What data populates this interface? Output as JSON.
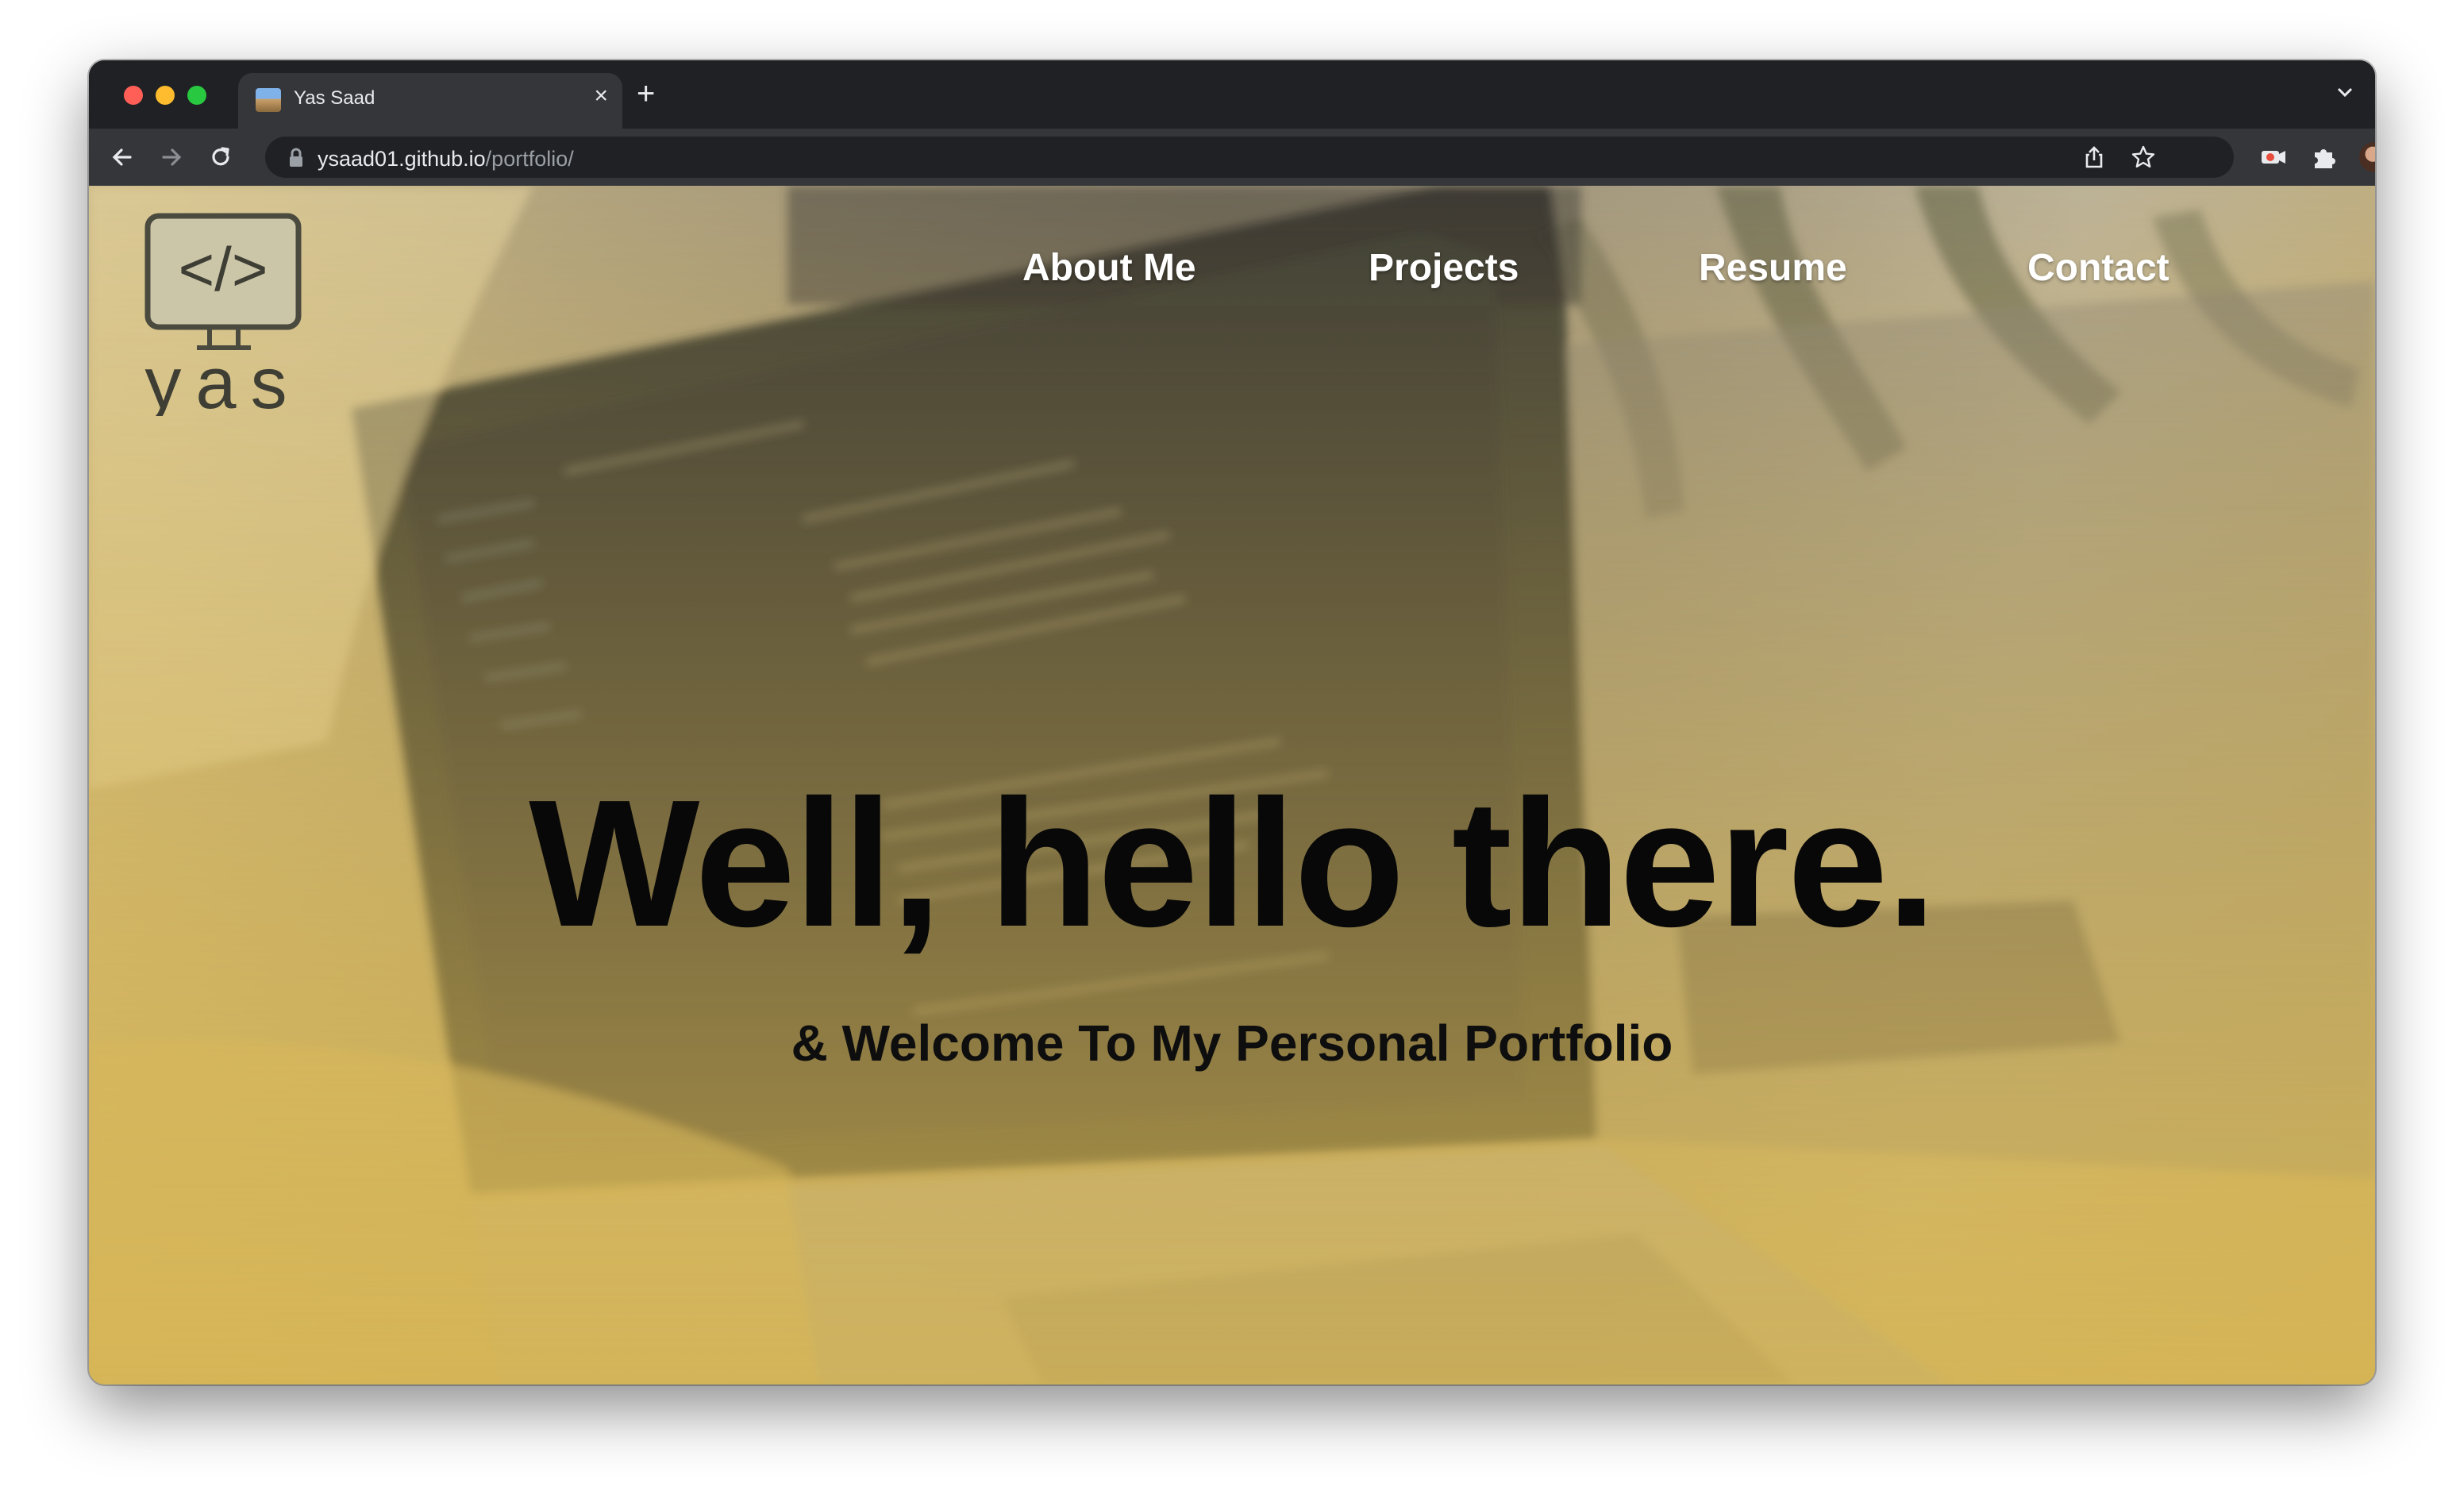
{
  "browser": {
    "tab_title": "Yas Saad",
    "url_host": "ysaad01.github.io",
    "url_path": "/portfolio/"
  },
  "site": {
    "logo_text": "yas",
    "logo_glyph": "</>",
    "nav": [
      "About Me",
      "Projects",
      "Resume",
      "Contact"
    ],
    "hero_title": "Well, hello there.",
    "hero_subtitle": "& Welcome To My Personal Portfolio"
  },
  "colors": {
    "overlay_yellow": "#d6b450",
    "nav_text": "#ffffff",
    "hero_text": "#080808"
  }
}
